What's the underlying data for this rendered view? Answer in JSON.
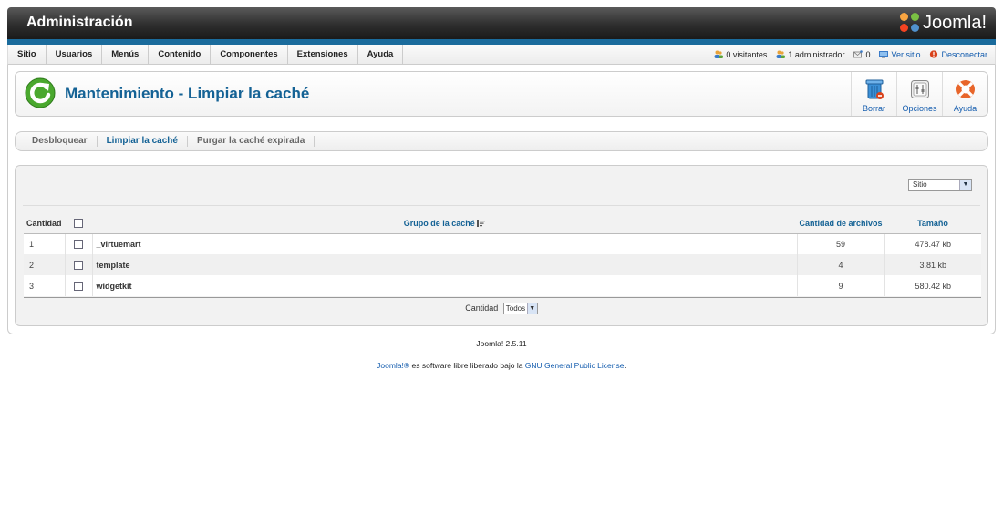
{
  "header": {
    "title": "Administración",
    "logo_text": "Joomla!"
  },
  "menu": [
    "Sitio",
    "Usuarios",
    "Menús",
    "Contenido",
    "Componentes",
    "Extensiones",
    "Ayuda"
  ],
  "status": {
    "visitors": "0 visitantes",
    "admins": "1 administrador",
    "messages": "0",
    "view_site": "Ver sitio",
    "logout": "Desconectar"
  },
  "page": {
    "title": "Mantenimiento - Limpiar la caché"
  },
  "toolbar": {
    "delete": "Borrar",
    "options": "Opciones",
    "help": "Ayuda"
  },
  "subnav": [
    "Desbloquear",
    "Limpiar la caché",
    "Purgar la caché expirada"
  ],
  "subnav_active": "Limpiar la caché",
  "filter": {
    "client_selected": "Sitio"
  },
  "table": {
    "headers": {
      "count": "Cantidad",
      "group": "Grupo de la caché",
      "files": "Cantidad de archivos",
      "size": "Tamaño"
    },
    "rows": [
      {
        "num": "1",
        "group": "_virtuemart",
        "files": "59",
        "size": "478.47 kb"
      },
      {
        "num": "2",
        "group": "template",
        "files": "4",
        "size": "3.81 kb"
      },
      {
        "num": "3",
        "group": "widgetkit",
        "files": "9",
        "size": "580.42 kb"
      }
    ]
  },
  "pager": {
    "label": "Cantidad",
    "selected": "Todos"
  },
  "footer": {
    "version": "Joomla! 2.5.11",
    "license_joomla": "Joomla!®",
    "license_mid": " es software libre liberado bajo la ",
    "license_link": "GNU General Public License",
    "license_end": "."
  },
  "colors": {
    "accent": "#146295",
    "link": "#135cae",
    "header_bar": "#1a6b9c"
  }
}
